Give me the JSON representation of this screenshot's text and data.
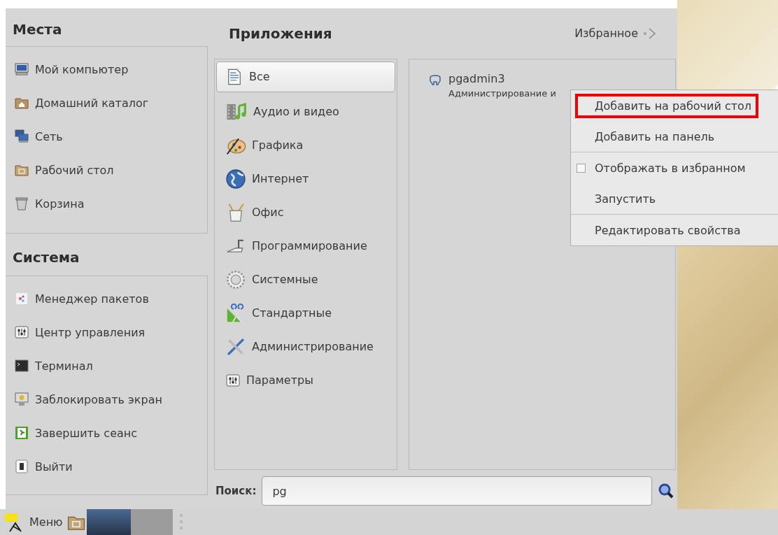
{
  "places": {
    "title": "Места",
    "items": [
      {
        "label": "Мой компьютер"
      },
      {
        "label": "Домашний каталог"
      },
      {
        "label": "Сеть"
      },
      {
        "label": "Рабочий стол"
      },
      {
        "label": "Корзина"
      }
    ]
  },
  "system": {
    "title": "Система",
    "items": [
      {
        "label": "Менеджер пакетов"
      },
      {
        "label": "Центр управления"
      },
      {
        "label": "Терминал"
      },
      {
        "label": "Заблокировать экран"
      },
      {
        "label": "Завершить сеанс"
      },
      {
        "label": "Выйти"
      }
    ]
  },
  "applications": {
    "title": "Приложения",
    "favorites": "Избранное",
    "categories": [
      {
        "label": "Все",
        "selected": true
      },
      {
        "label": "Аудио и видео",
        "selected": false
      },
      {
        "label": "Графика",
        "selected": false
      },
      {
        "label": "Интернет",
        "selected": false
      },
      {
        "label": "Офис",
        "selected": false
      },
      {
        "label": "Программирование",
        "selected": false
      },
      {
        "label": "Системные",
        "selected": false
      },
      {
        "label": "Стандартные",
        "selected": false
      },
      {
        "label": "Администрирование",
        "selected": false
      },
      {
        "label": "Параметры",
        "selected": false
      }
    ],
    "results": [
      {
        "name": "pgadmin3",
        "description": "Администрирование и"
      }
    ]
  },
  "search": {
    "label": "Поиск:",
    "value": "pg"
  },
  "context_menu": [
    {
      "label": "Добавить на рабочий стол",
      "kind": "action",
      "highlighted": true,
      "separator_before": false
    },
    {
      "label": "Добавить на панель",
      "kind": "action",
      "highlighted": false,
      "separator_before": false
    },
    {
      "label": "Отображать в избранном",
      "kind": "check",
      "checked": false,
      "highlighted": false,
      "separator_before": true
    },
    {
      "label": "Запустить",
      "kind": "action",
      "highlighted": false,
      "separator_before": false
    },
    {
      "label": "Редактировать свойства",
      "kind": "action",
      "highlighted": false,
      "separator_before": true
    }
  ],
  "taskbar": {
    "menu_label": "Меню"
  }
}
